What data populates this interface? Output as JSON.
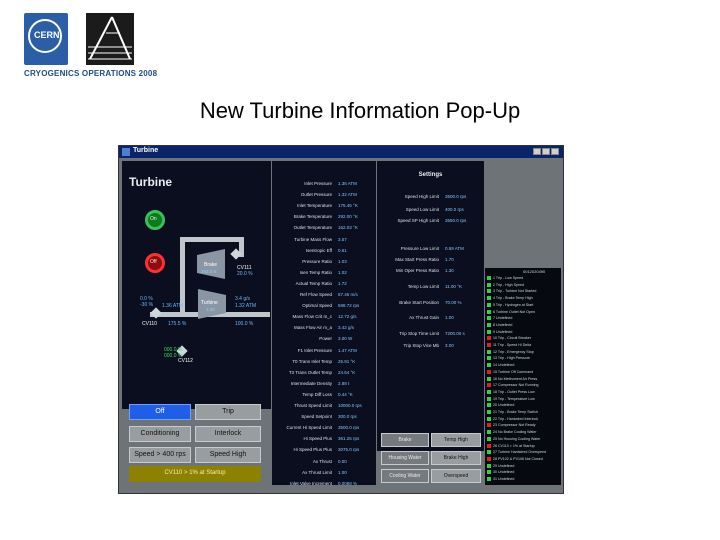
{
  "header": {
    "cern_logo_text": "CERN",
    "cryo_caption": "CRYOGENICS OPERATIONS 2008"
  },
  "slide_title": "New Turbine Information Pop-Up",
  "window": {
    "title": "Turbine",
    "main_heading": "Turbine",
    "on_label": "On",
    "off_label": "Off",
    "brake_label": "Brake",
    "brake_value": "293.0 K",
    "turbine_label": "Turbine",
    "turbine_value": "1.00",
    "cv111_label": "CV111",
    "cv111_value": "20.0 %",
    "in_pct": "0.0 %",
    "in_pct2": "-30 %",
    "in_press": "1.36 ATM",
    "out_press_a": "3.4 g/s",
    "out_press_b": "1.32 ATM",
    "cv110_label": "CV110",
    "flow_pct": "175.5 %",
    "right_pct": "100.0 %",
    "cv112_label": "CV112",
    "cv112_a": "000.0 %",
    "cv112_b": "000.0 %",
    "buttons": {
      "off": "Off",
      "trip": "Trip",
      "conditioning": "Conditioning",
      "interlock": "Interlock",
      "speed_400": "Speed > 400 rps",
      "speed_high": "Speed High",
      "cv110_startup": "CV110 > 1% at Startup"
    },
    "parameters": [
      {
        "label": "Inlet Pressure",
        "value": "1.36 ATM"
      },
      {
        "label": "Outlet Pressure",
        "value": "1.32 ATM"
      },
      {
        "label": "Inlet Temperature",
        "value": "175.45 °K"
      },
      {
        "label": "Brake Temperature",
        "value": "292.00 °K"
      },
      {
        "label": "Outlet Temperature",
        "value": "162.03 °K"
      },
      {
        "label": "Turbine Mass Flow",
        "value": "3.57"
      },
      {
        "label": "Isentropic Eff",
        "value": "0.61"
      },
      {
        "label": "Pressure Ratio",
        "value": "1.03"
      },
      {
        "label": "Isen Temp Ratio",
        "value": "1.02"
      },
      {
        "label": "Actual Temp Ratio",
        "value": "1.72"
      },
      {
        "label": "Ref Flow Speed",
        "value": "67.46 m/s"
      },
      {
        "label": "Optimal Speed",
        "value": "598.72 rps"
      },
      {
        "label": "Mass Flow Crit m_c",
        "value": "12.72 g/s"
      },
      {
        "label": "Mass Flow Air m_a",
        "value": "3.42 g/s"
      },
      {
        "label": "Power",
        "value": "3.00 W"
      },
      {
        "label": "F1 Inlet Pressure",
        "value": "1.47 ATM"
      },
      {
        "label": "T0 Trans Inlet Temp",
        "value": "25.91 °K"
      },
      {
        "label": "T3 Trans Outlet Temp",
        "value": "24.64 °K"
      },
      {
        "label": "Intermediate Density",
        "value": "2.88 t"
      },
      {
        "label": "Temp Diff Loss",
        "value": "0.44 °K"
      },
      {
        "label": "Thrust Speed Limit",
        "value": "10000.0 rps"
      },
      {
        "label": "Speed Setpoint",
        "value": "300.0 rps"
      },
      {
        "label": "Current Hi Speed Limit",
        "value": "3500.0 rps"
      },
      {
        "label": "Hi Speed Plus",
        "value": "361.25 rps"
      },
      {
        "label": "Hi Speed Plus Plus",
        "value": "3075.0 rps"
      },
      {
        "label": "Ax Thrust",
        "value": "0.00"
      },
      {
        "label": "Ax Thrust Limit",
        "value": "1.00"
      },
      {
        "label": "Inlet Valve Increment",
        "value": "0.0088 %"
      }
    ],
    "settings": {
      "heading": "Settings",
      "items": [
        {
          "label": "Speed High Limit",
          "value": "3500.0 rps"
        },
        {
          "label": "Speed Low Limit",
          "value": "400.0 rps"
        },
        {
          "label": "Speed SP High Limit",
          "value": "3550.0 rps"
        },
        {
          "label": "Pressure Low Limit",
          "value": "0.59 ATM"
        },
        {
          "label": "Max Start Press Ratio",
          "value": "1.70"
        },
        {
          "label": "Min Oper Press Ratio",
          "value": "1.30"
        },
        {
          "label": "Temp Low Limit",
          "value": "11.00 °K"
        },
        {
          "label": "Brake Start Position",
          "value": "70.00 %"
        },
        {
          "label": "Ax Thrust Gain",
          "value": "1.00"
        },
        {
          "label": "Trip Stop Time Limit",
          "value": "7200.00 s"
        },
        {
          "label": "Trip Stop Vice Mb",
          "value": "3.00"
        }
      ]
    },
    "bottom_buttons": {
      "brake": "Brake",
      "temp_high": "Temp High",
      "housing_water": "Housing Water",
      "brake_high": "Brake High",
      "cooling_water": "Cooling Water",
      "overspeed": "Overspeed"
    },
    "trip_list": {
      "header": "0012020490",
      "items": [
        {
          "text": "1  Trip - Low Speed",
          "color": "#2fd04a"
        },
        {
          "text": "2  Trip - High Speed",
          "color": "#2fd04a"
        },
        {
          "text": "3  Trip - Turbine Not Started",
          "color": "#2fd04a"
        },
        {
          "text": "4  Trip - Brake Temp High",
          "color": "#2fd04a"
        },
        {
          "text": "5  Trip - Hydrogen at Start",
          "color": "#2fd04a"
        },
        {
          "text": "6  Turbine Outlet Not Open",
          "color": "#2fd04a"
        },
        {
          "text": "7  Undefined",
          "color": "#2fd04a"
        },
        {
          "text": "8  Undefined",
          "color": "#2fd04a"
        },
        {
          "text": "9  Undefined",
          "color": "#2fd04a"
        },
        {
          "text": "10 Trip - Circuit Breaker",
          "color": "#e02020"
        },
        {
          "text": "11 Trip - Speed Hi Delta",
          "color": "#e02020"
        },
        {
          "text": "12 Trip - Emergency Stop",
          "color": "#2fd04a"
        },
        {
          "text": "13 Trip - High Pressure",
          "color": "#2fd04a"
        },
        {
          "text": "14 Undefined",
          "color": "#2fd04a"
        },
        {
          "text": "15 Turbine Off Command",
          "color": "#e02020"
        },
        {
          "text": "16 No Mettrument Air Press",
          "color": "#2fd04a"
        },
        {
          "text": "17 Compressor Not Running",
          "color": "#e02020"
        },
        {
          "text": "18 Trip - Outlet Press Low",
          "color": "#2fd04a"
        },
        {
          "text": "19 Trip - Temperature Low",
          "color": "#2fd04a"
        },
        {
          "text": "20 Undefined",
          "color": "#2fd04a"
        },
        {
          "text": "21 Trip - Brake Temp Switch",
          "color": "#2fd04a"
        },
        {
          "text": "22 Trip - Hardwired Interlock",
          "color": "#2fd04a"
        },
        {
          "text": "23 Compressor Not Ready",
          "color": "#e02020"
        },
        {
          "text": "24 No Brake Cooling Water",
          "color": "#2fd04a"
        },
        {
          "text": "25 No Housing Cooling Water",
          "color": "#2fd04a"
        },
        {
          "text": "26 CV110 > 1% at Startup",
          "color": "#e02020"
        },
        {
          "text": "27 Turbine Hardwired Overspeed",
          "color": "#2fd04a"
        },
        {
          "text": "28 PV102 & PV106 Not Closed",
          "color": "#e02020"
        },
        {
          "text": "29 Undefined",
          "color": "#2fd04a"
        },
        {
          "text": "30 Undefined",
          "color": "#2fd04a"
        },
        {
          "text": "31 Undefined",
          "color": "#2fd04a"
        }
      ]
    }
  }
}
